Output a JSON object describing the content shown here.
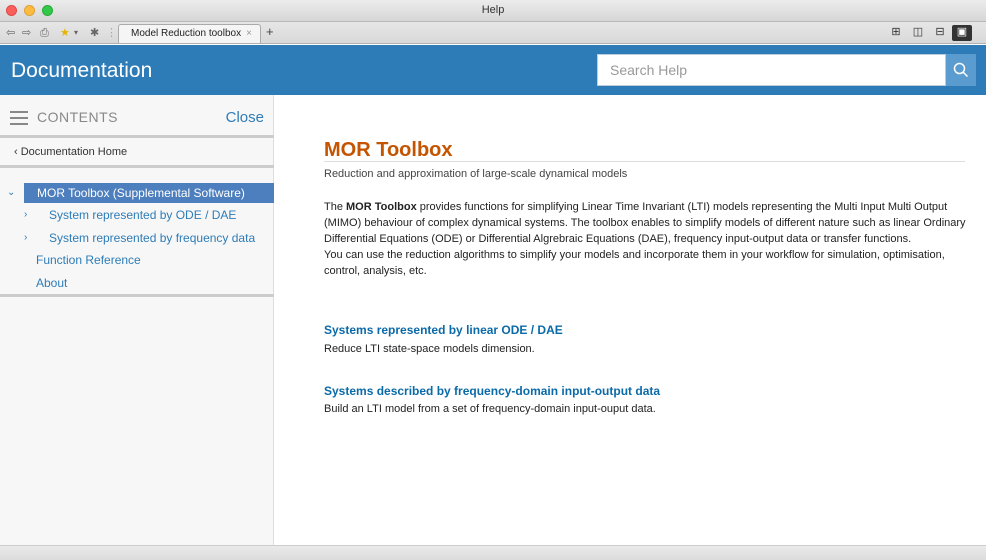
{
  "window": {
    "title": "Help"
  },
  "browser": {
    "tab_label": "Model Reduction toolbox",
    "tab_close": "×",
    "tab_add": "+"
  },
  "header": {
    "title": "Documentation",
    "search_placeholder": "Search Help"
  },
  "sidebar": {
    "contents_label": "CONTENTS",
    "close_label": "Close",
    "doc_home": "‹ Documentation Home",
    "items": [
      {
        "label": "MOR Toolbox (Supplemental Software)",
        "arrow": "⌄"
      },
      {
        "label": "System represented by ODE / DAE",
        "arrow": "›"
      },
      {
        "label": "System represented by frequency data",
        "arrow": "›"
      },
      {
        "label": "Function Reference",
        "arrow": ""
      },
      {
        "label": "About",
        "arrow": ""
      }
    ]
  },
  "main": {
    "title": "MOR Toolbox",
    "subtitle": "Reduction and approximation of large-scale dynamical models",
    "desc_prefix": "The ",
    "desc_bold": "MOR Toolbox",
    "desc_rest": " provides functions for simplifying Linear Time Invariant (LTI) models representing the Multi Input Multi Output (MIMO) behaviour of complex dynamical systems. The toolbox enables to simplify models of different nature such as linear Ordinary Differential Equations (ODE) or Differential Algrebraic Equations (DAE), frequency input-output data or transfer functions.",
    "desc_second": "You can use the reduction algorithms to simplify your models and incorporate them in your workflow for simulation, optimisation, control, analysis, etc.",
    "sections": [
      {
        "link": "Systems represented by linear ODE / DAE",
        "desc": "Reduce LTI state-space models dimension."
      },
      {
        "link": "Systems described by frequency-domain input-output data",
        "desc": "Build an LTI model from a set of frequency-domain input-ouput data."
      }
    ]
  },
  "colors": {
    "header_bg": "#2e7cb7",
    "title_orange": "#c45400",
    "link_blue": "#0b6aa8",
    "selected_bg": "#4d7ebd"
  }
}
